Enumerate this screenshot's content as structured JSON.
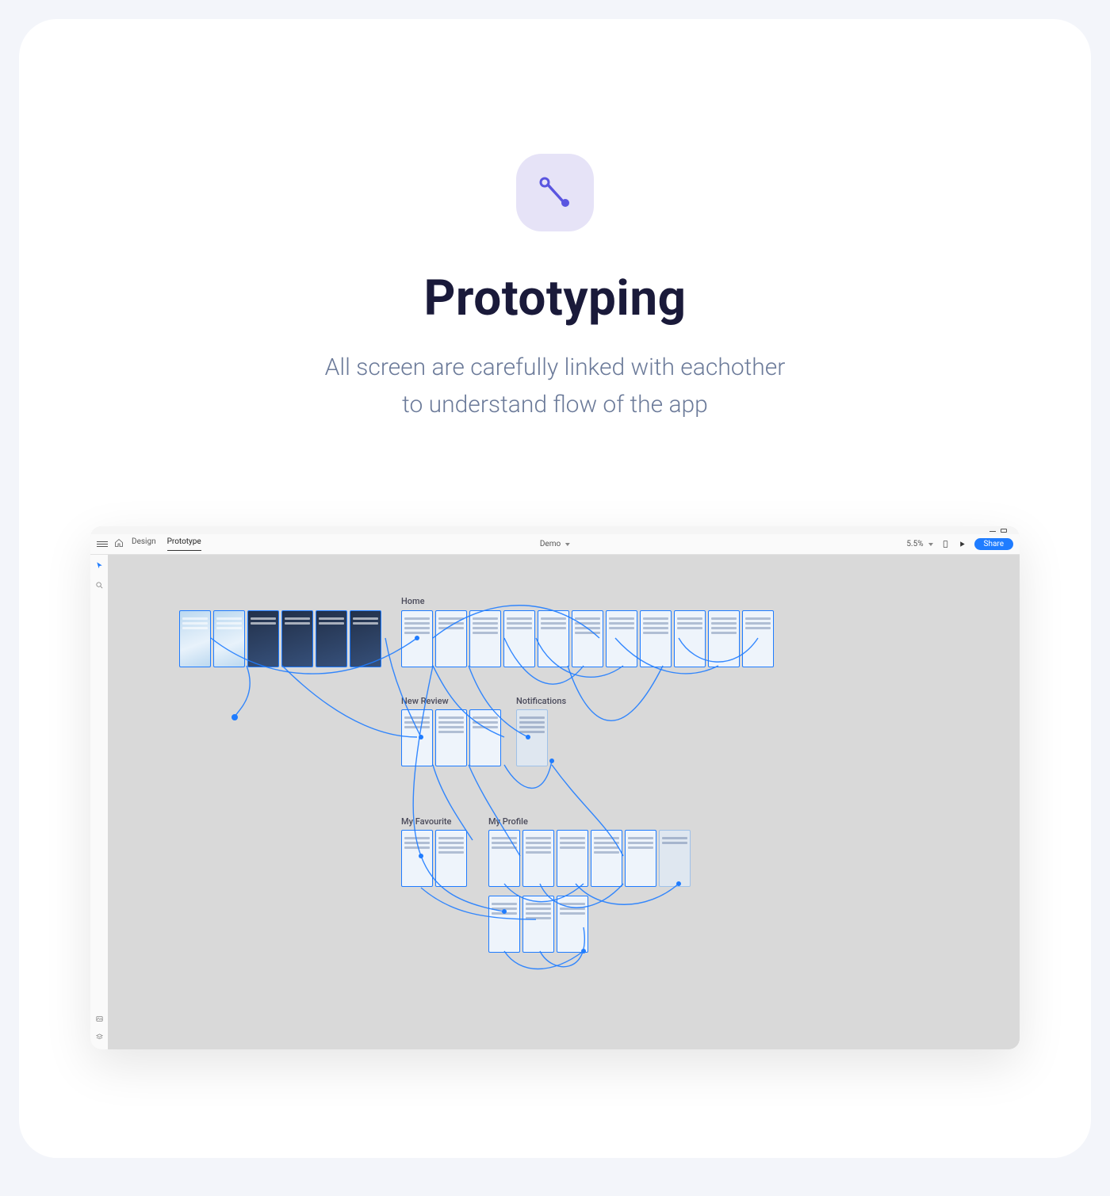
{
  "hero": {
    "title": "Prototyping",
    "subtitle_line1": "All screen are carefully linked with eachother",
    "subtitle_line2": "to understand flow of the app"
  },
  "app": {
    "tabs": {
      "design": "Design",
      "prototype": "Prototype"
    },
    "file_name": "Demo",
    "zoom": "5.5%",
    "share_label": "Share",
    "sections": {
      "home": "Home",
      "new_review": "New Review",
      "notifications": "Notifications",
      "my_favourite": "My Favourite",
      "my_profile": "My Profile"
    }
  }
}
